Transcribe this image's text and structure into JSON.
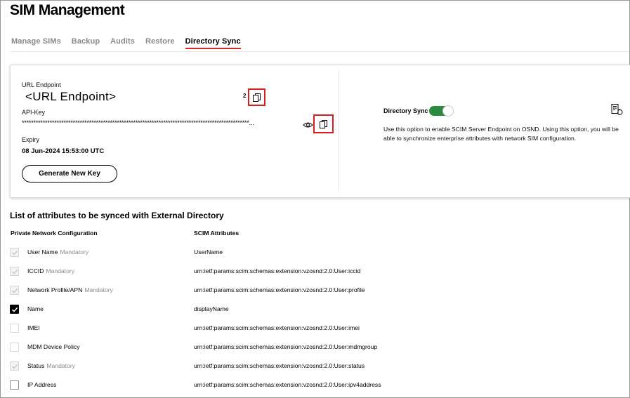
{
  "page": {
    "title": "SIM Management"
  },
  "tabs": [
    {
      "label": "Manage SIMs",
      "active": false
    },
    {
      "label": "Backup",
      "active": false
    },
    {
      "label": "Audits",
      "active": false
    },
    {
      "label": "Restore",
      "active": false
    },
    {
      "label": "Directory Sync",
      "active": true
    }
  ],
  "endpoint_card": {
    "url_label": "URL Endpoint",
    "url_value": "<URL Endpoint>",
    "annotation_number": "2",
    "api_key_label": "API-Key",
    "api_key_masked": "**************************************************************************************************...",
    "expiry_label": "Expiry",
    "expiry_value": "08 Jun-2024 15:53:00 UTC",
    "generate_button": "Generate New Key",
    "icons": {
      "copy": "copy-icon",
      "show": "eye-icon"
    },
    "highlight_color": "#d42020"
  },
  "directory_sync": {
    "label": "Directory Sync",
    "enabled": true,
    "toggle_color": "#2a8a3e",
    "description": "Use this option to enable SCIM Server Endpoint on OSND. Using this option, you will be able to synchronize enterprise attributes with network SIM configuration.",
    "icon": "refresh-list-icon"
  },
  "attributes": {
    "title": "List of attributes to be synced with External Directory",
    "columns": [
      "Private Network Configuration",
      "SCIM Attributes"
    ],
    "rows": [
      {
        "name": "User Name",
        "tag": "Mandatory",
        "scim": "UserName",
        "state": "disabled"
      },
      {
        "name": "ICCID",
        "tag": "Mandatory",
        "scim": "urn:ietf:params:scim:schemas:extension:vzosnd:2.0:User:iccid",
        "state": "disabled"
      },
      {
        "name": "Network Profile/APN",
        "tag": "Mandatory",
        "scim": "urn:ietf:params:scim:schemas:extension:vzosnd:2.0:User:profile",
        "state": "disabled"
      },
      {
        "name": "Name",
        "tag": "",
        "scim": "displayName",
        "state": "checked"
      },
      {
        "name": "IMEI",
        "tag": "",
        "scim": "urn:ietf:params:scim:schemas:extension:vzosnd:2.0:User:imei",
        "state": "unchecked-light"
      },
      {
        "name": "MDM Device Policy",
        "tag": "",
        "scim": "urn:ietf:params:scim:schemas:extension:vzosnd:2.0:User:mdmgroup",
        "state": "unchecked-light"
      },
      {
        "name": "Status",
        "tag": "Mandatory",
        "scim": "urn:ietf:params:scim:schemas:extension:vzosnd:2.0:User:status",
        "state": "disabled"
      },
      {
        "name": "IP Address",
        "tag": "",
        "scim": "urn:ietf:params:scim:schemas:extension:vzosnd:2.0:User:ipv4address",
        "state": "unchecked"
      }
    ]
  }
}
